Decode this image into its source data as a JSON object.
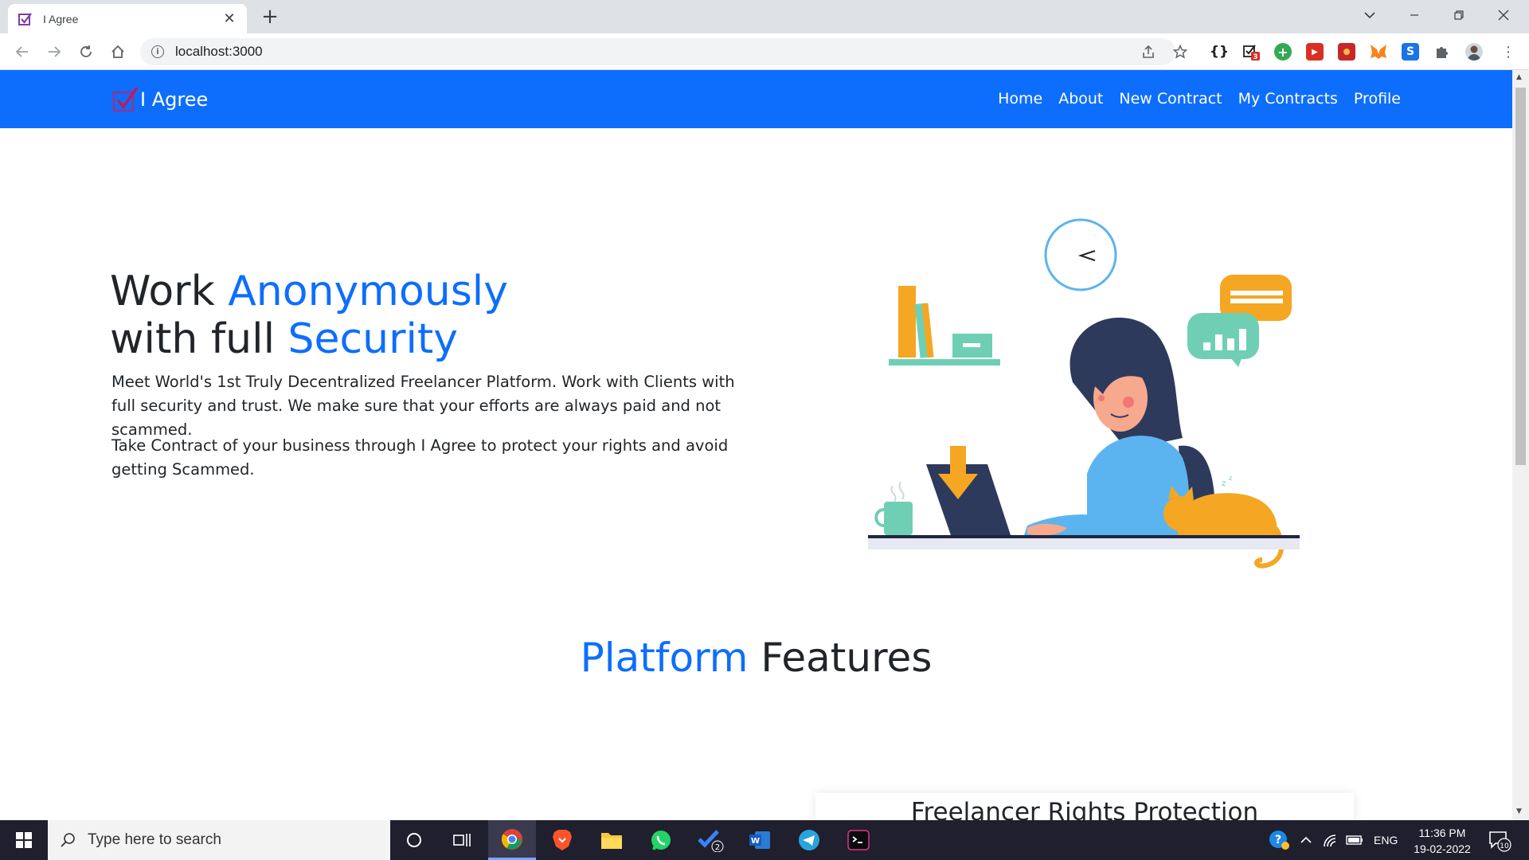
{
  "browser": {
    "tab_title": "I Agree",
    "url": "localhost:3000"
  },
  "extensions": [
    {
      "name": "braces-icon",
      "label": "{}",
      "color": "#202124"
    },
    {
      "name": "checklist-icon",
      "label": "",
      "color": "#202124",
      "badge": "3"
    },
    {
      "name": "plus-circle-icon",
      "label": "+",
      "color": "#34a853"
    },
    {
      "name": "red-arrow-icon",
      "label": "▶",
      "color": "#d93025"
    },
    {
      "name": "red-square-icon",
      "label": "■",
      "color": "#c62828"
    },
    {
      "name": "metamask-icon",
      "label": "",
      "color": "#f6851b"
    },
    {
      "name": "s-icon",
      "label": "S",
      "color": "#1a73e8"
    },
    {
      "name": "puzzle-icon",
      "label": "",
      "color": "#5f6368"
    }
  ],
  "site": {
    "brand": "I Agree",
    "nav": [
      "Home",
      "About",
      "New Contract",
      "My Contracts",
      "Profile"
    ],
    "hero": {
      "line1_plain": "Work ",
      "line1_blue": "Anonymously",
      "line2_plain": "with full ",
      "line2_blue": "Security",
      "p1": "Meet World's 1st Truly Decentralized Freelancer Platform. Work with Clients with full security and trust. We make sure that your efforts are always paid and not scammed.",
      "p2": "Take Contract of your business through I Agree to protect your rights and avoid getting Scammed."
    },
    "features": {
      "title_blue": "Platform",
      "title_plain": " Features",
      "card_title": "Freelancer Rights Protection"
    }
  },
  "taskbar": {
    "search_placeholder": "Type here to search",
    "language": "ENG",
    "time": "11:36 PM",
    "date": "19-02-2022",
    "notification_count": "10",
    "vscode_badge": "2"
  },
  "colors": {
    "primary": "#0d6efd",
    "accent_orange": "#f5a623",
    "accent_teal": "#6fcfb4"
  }
}
